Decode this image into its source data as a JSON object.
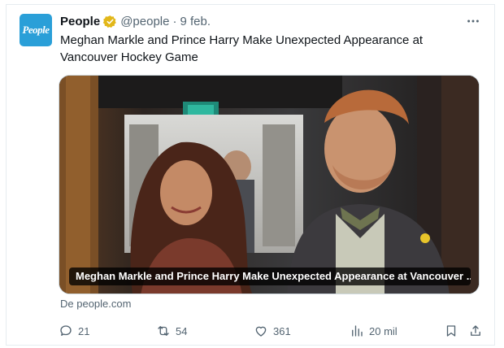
{
  "account": {
    "avatar_text": "People",
    "name": "People",
    "handle": "@people",
    "separator": "·",
    "date": "9 feb."
  },
  "more_label": "•••",
  "tweet": {
    "text": "Meghan Markle and Prince Harry Make Unexpected Appearance at Vancouver Hockey Game"
  },
  "media": {
    "caption": "Meghan Markle and Prince Harry Make Unexpected Appearance at Vancouver ..."
  },
  "source": "De people.com",
  "actions": {
    "replies": "21",
    "reposts": "54",
    "likes": "361",
    "views": "20 mil"
  },
  "colors": {
    "accent": "#1d9bf0",
    "verified_badge": "#e2b719",
    "muted_text": "#536471"
  }
}
